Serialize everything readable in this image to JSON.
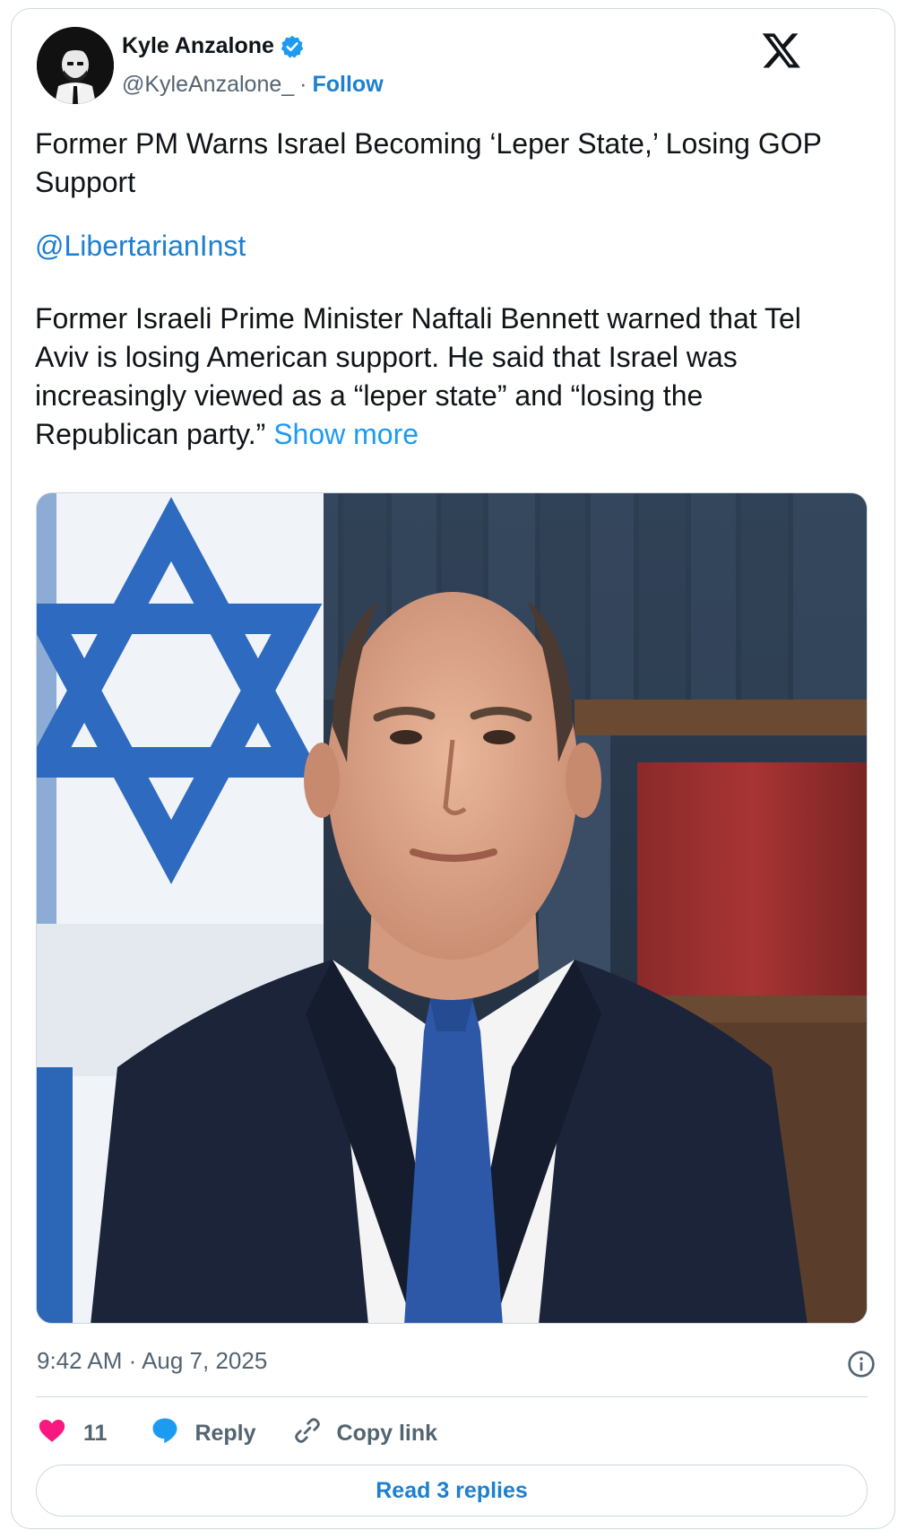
{
  "author": {
    "name": "Kyle Anzalone",
    "handle": "@KyleAnzalone_",
    "separator": "·",
    "follow_label": "Follow",
    "verified_color": "#1d9bf0"
  },
  "tweet": {
    "title": "Former PM Warns Israel Becoming ‘Leper State,’ Losing GOP Support",
    "mention": "@LibertarianInst",
    "body": "Former Israeli Prime Minister Naftali Bennett warned that Tel Aviv is losing American support. He said that Israel was increasingly viewed as a “leper state” and “losing the Republican party.”",
    "show_more": "Show more",
    "timestamp": "9:42 AM · Aug 7, 2025"
  },
  "actions": {
    "like_count": "11",
    "reply_label": "Reply",
    "copy_link_label": "Copy link",
    "read_replies_label": "Read 3 replies"
  },
  "icons": {
    "brand": "x-logo-icon",
    "verified": "verified-badge-icon",
    "like": "heart-icon",
    "reply": "speech-bubble-icon",
    "copy": "link-icon",
    "info": "info-icon"
  },
  "colors": {
    "accent": "#1d9bf0",
    "link": "#1d7fd0",
    "like": "#f91880",
    "muted": "#536471",
    "border": "#cfd9de"
  }
}
